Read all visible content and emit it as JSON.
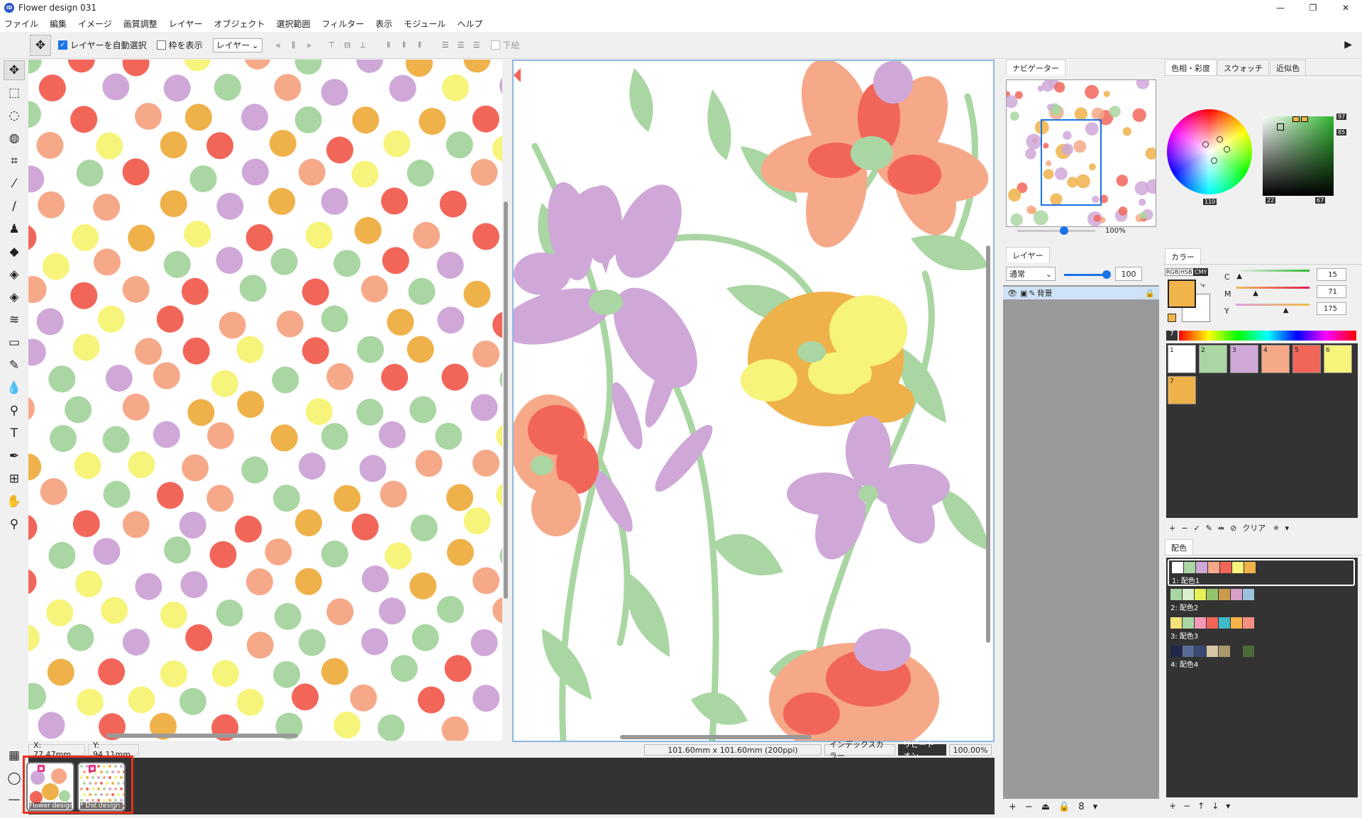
{
  "window": {
    "title": "Flower design 031",
    "app_icon": "ID"
  },
  "menu": [
    "ファイル",
    "編集",
    "イメージ",
    "画質調整",
    "レイヤー",
    "オブジェクト",
    "選択範囲",
    "フィルター",
    "表示",
    "モジュール",
    "ヘルプ"
  ],
  "toolbar": {
    "auto_select_label": "レイヤーを自動選択",
    "auto_select_checked": true,
    "show_frame_label": "枠を表示",
    "show_frame_checked": false,
    "target_select": "レイヤー",
    "draw_under_label": "下絵"
  },
  "statusbar": {
    "x_readout": "X:  77.47mm",
    "y_readout": "Y:   94.11mm",
    "doc_size": "101.60mm x 101.60mm (200ppi)",
    "color_mode": "インデックスカラー",
    "repeat": "リピートオン",
    "zoom": "100.00%"
  },
  "documents": [
    {
      "label": "Flower design"
    },
    {
      "label": "* Dot design"
    }
  ],
  "navigator": {
    "tab": "ナビゲーター",
    "zoom": "100%",
    "zoom_fraction": 0.6
  },
  "layers": {
    "tab": "レイヤー",
    "blend": "通常",
    "opacity": "100",
    "opacity_fraction": 1.0,
    "layer_name": "背景"
  },
  "color_picker": {
    "tabs": [
      "色相・彩度",
      "スウォッチ",
      "近似色"
    ],
    "hue": "110",
    "sat": "22",
    "val": "67",
    "top_r": "97",
    "top_r2": "85"
  },
  "color_panel": {
    "tab": "カラー",
    "modes": [
      "RGB",
      "HSB",
      "CMY"
    ],
    "current": "#f0b44a",
    "c_label": "C",
    "c_value": "15",
    "c_fraction": 0.06,
    "m_label": "M",
    "m_value": "71",
    "m_fraction": 0.28,
    "y_label": "Y",
    "y_value": "175",
    "y_fraction": 0.69,
    "palette_count": "7",
    "clear_label": "クリア"
  },
  "swatches": [
    {
      "n": "1",
      "color": "#ffffff"
    },
    {
      "n": "2",
      "color": "#a9d6a2"
    },
    {
      "n": "3",
      "color": "#cfa8d8"
    },
    {
      "n": "4",
      "color": "#f6a988"
    },
    {
      "n": "5",
      "color": "#f2665a"
    },
    {
      "n": "6",
      "color": "#f6f47a"
    },
    {
      "n": "7",
      "color": "#efb14a"
    }
  ],
  "haishoku": {
    "tab": "配色",
    "sets": [
      {
        "label": "1: 配色1",
        "colors": [
          "#ffffff",
          "#a9d6a2",
          "#cfa8d8",
          "#f6a988",
          "#f2665a",
          "#f6f47a",
          "#efb14a"
        ]
      },
      {
        "label": "2: 配色2",
        "colors": [
          "#a9d6a2",
          "#d9f0d0",
          "#e7f05a",
          "#93c36c",
          "#c79b4a",
          "#d7a0c8",
          "#9ec1e0"
        ]
      },
      {
        "label": "3: 配色3",
        "colors": [
          "#f6e27a",
          "#a9d6a2",
          "#f29ab8",
          "#f2665a",
          "#3fb8c8",
          "#f6b34a",
          "#f79082"
        ]
      },
      {
        "label": "4: 配色4",
        "colors": [
          "#20284a",
          "#5a6a98",
          "#3a4a74",
          "#d8c6a8",
          "#a8986a",
          "#333333",
          "#4a6a38"
        ]
      }
    ]
  }
}
